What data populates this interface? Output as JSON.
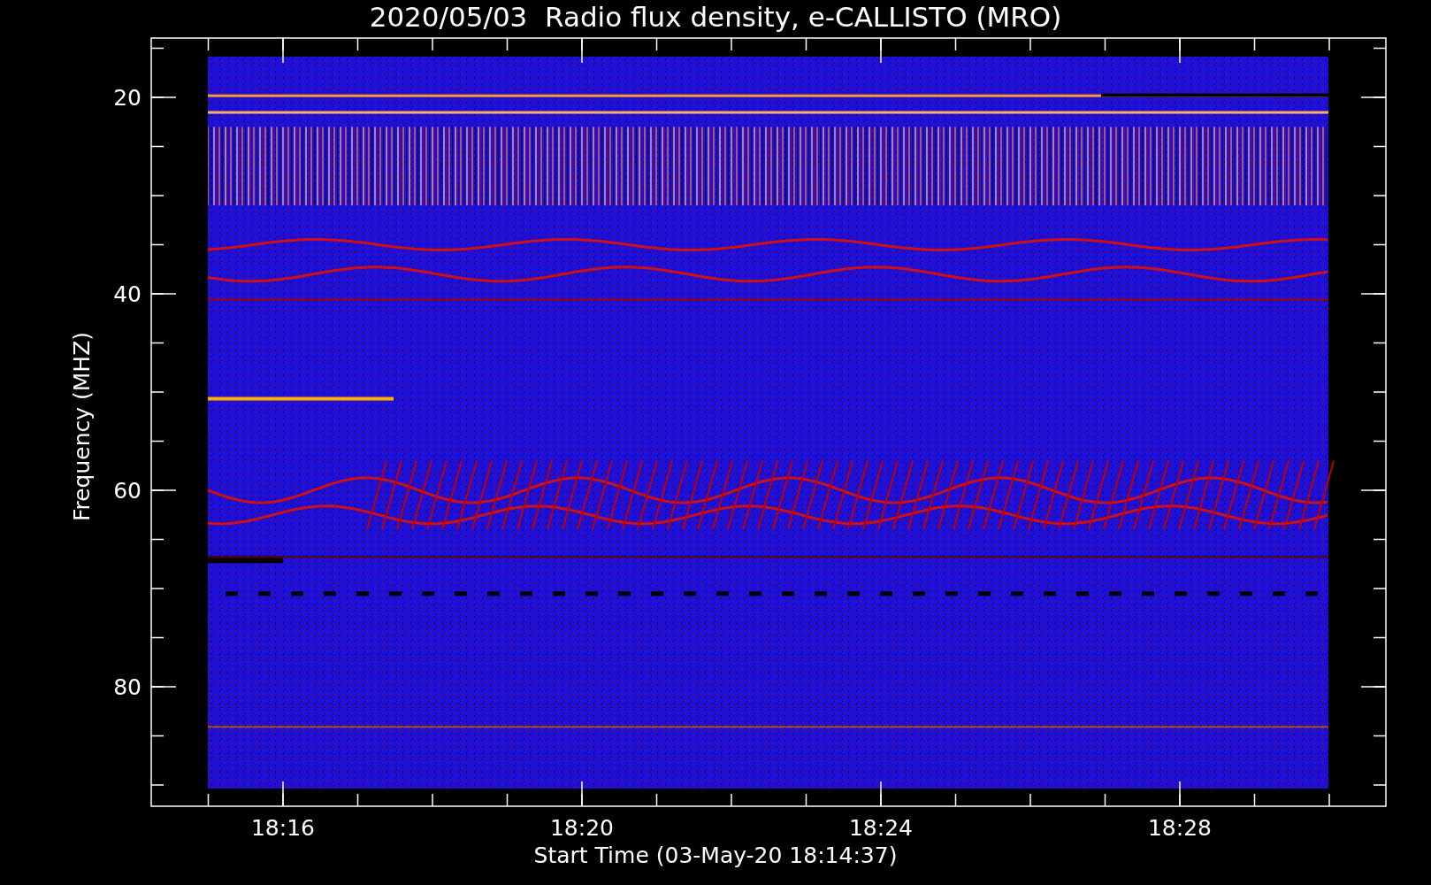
{
  "title": "2020/05/03  Radio flux density, e-CALLISTO (MRO)",
  "y_axis": {
    "title": "Frequency (MHZ)",
    "ticks": [
      "20",
      "40",
      "60",
      "80"
    ]
  },
  "x_axis": {
    "title": "Start Time (03-May-20 18:14:37)",
    "ticks": [
      "18:16",
      "18:20",
      "18:24",
      "18:28"
    ]
  }
}
